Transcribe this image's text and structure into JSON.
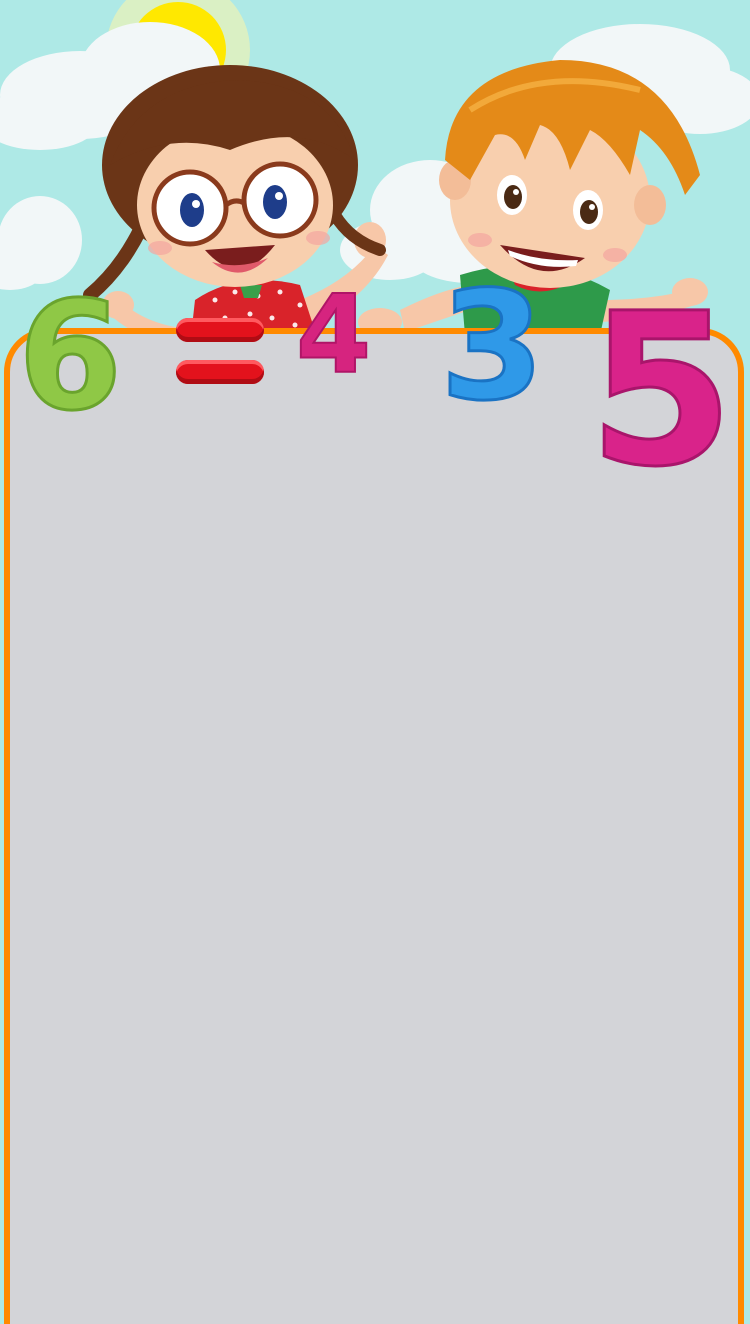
{
  "scene": {
    "digits": {
      "six": "6",
      "four": "4",
      "three": "3",
      "five": "5"
    },
    "colors": {
      "sky": "#aee9e6",
      "board": "#d3d4d8",
      "frame": "#ff8a00",
      "green": "#8fc846",
      "red": "#e3121c",
      "pink": "#d6247f",
      "blue": "#2f99e8",
      "magenta": "#d9238a"
    },
    "figures": [
      "sun-icon",
      "cloud-icon",
      "girl-character",
      "boy-character"
    ]
  }
}
